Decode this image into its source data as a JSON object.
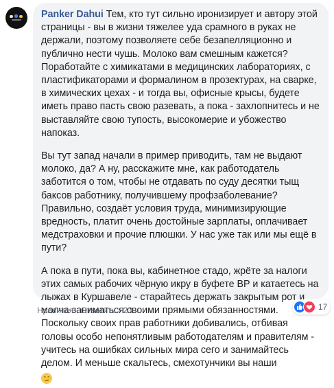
{
  "comment": {
    "author": "Panker Dahui",
    "paragraphs": [
      [
        "Тем, кто тут сильно иронизирует и автору этой",
        "страницы - вы в жизни тяжелее уда срамного в руках не",
        "держали, поэтому позволяете себе безапелляционно и публично",
        "нести чушь. Молоко вам смешным кажется? Поработайте с",
        "химикатами в медицинских лабораториях, с пластификаторами и",
        "формалином в прозектурах, на сварке, в химических цехах - и",
        "тогда вы, офисные крысы, будете иметь право пасть свою",
        "разевать, а пока - захлопнитесь и не выставляйте свою тупость,",
        "высокомерие и убожество напоказ."
      ],
      [
        "Вы тут запад начали в пример приводить, там не выдают молоко,",
        "да? А ну, расскажите мне, как работодатель заботится о том,",
        "чтобы не отдавать по суду десятки тыщ баксов работнику,",
        "получившему профзаболевание? Правильно, создаёт условия",
        "труда, минимизирующие вредность, платит очень достойные",
        "зарплаты, оплачивает медстраховки и прочие плюшки. У нас уже",
        "так или мы ещё в пути?"
      ],
      [
        "А пока в пути, пока вы, кабинетное стадо, жрёте за налоги этих",
        "самых рабочих чёрную икру в буфете ВР и катаетесь на лыжах в",
        "Куршавеле - старайтесь держать закрытым рот и молча",
        "заниматься своими прямыми обязанностями. Поскольку своих",
        "прав работники добивались, отбивая головы особо",
        "непонятливым работодателям и правителям - учитесь на ошибках",
        "сильных мира сего и занимайтесь делом. И меньше скальтесь,",
        "смехотунчики вы наши"
      ]
    ],
    "trailing_emoji": "smirk-emoji"
  },
  "actions": {
    "like": "Нравится",
    "sep1": " · ",
    "reply": "Ответить",
    "sep2": " · ",
    "time": "23 ч."
  },
  "reactions": {
    "count": "17",
    "icons": [
      "like-icon",
      "love-icon"
    ]
  },
  "colors": {
    "author": "#385898",
    "bubble": "#f2f3f5",
    "text": "#1c1e21",
    "meta": "#606770",
    "like": "#1877f2",
    "love": "#f33e58"
  }
}
